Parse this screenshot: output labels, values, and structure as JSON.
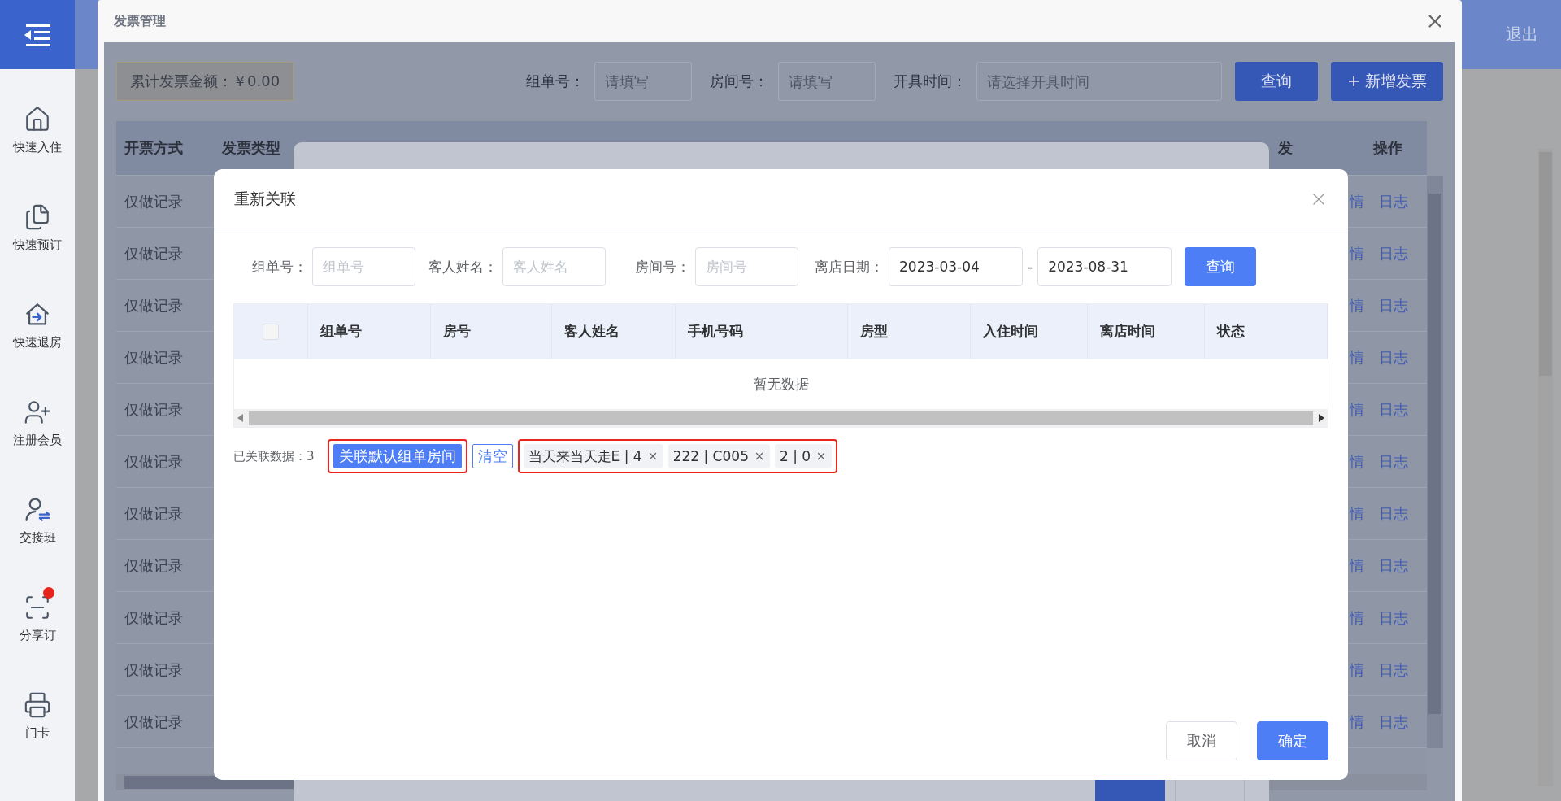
{
  "sidebar": {
    "items": [
      {
        "label": "快速入住",
        "badge": false
      },
      {
        "label": "快速预订",
        "badge": false
      },
      {
        "label": "快速退房",
        "badge": false
      },
      {
        "label": "注册会员",
        "badge": false
      },
      {
        "label": "交接班",
        "badge": false
      },
      {
        "label": "分享订",
        "badge": true
      },
      {
        "label": "门卡",
        "badge": false
      }
    ]
  },
  "top_bar": {
    "logout": "退出"
  },
  "invoice_window": {
    "title": "发票管理",
    "summary": "累计发票金额：￥0.00",
    "filters": [
      {
        "kind": "text",
        "label": "组单号：",
        "placeholder": "请填写"
      },
      {
        "kind": "text",
        "label": "房间号：",
        "placeholder": "请填写"
      },
      {
        "kind": "date",
        "label": "开具时间：",
        "placeholder": "请选择开具时间"
      }
    ],
    "buttons": [
      {
        "label": "查询"
      },
      {
        "label": "+ 新增发票"
      }
    ],
    "table": {
      "columns": [
        "开票方式",
        "发票类型",
        "发"
      ],
      "actions_header": "操作",
      "rows": [
        {
          "method": "仅做记录",
          "actions": [
            "情",
            "日志"
          ]
        },
        {
          "method": "仅做记录",
          "actions": [
            "情",
            "日志"
          ]
        },
        {
          "method": "仅做记录",
          "actions": [
            "情",
            "日志"
          ]
        },
        {
          "method": "仅做记录",
          "actions": [
            "情",
            "日志"
          ]
        },
        {
          "method": "仅做记录",
          "actions": [
            "情",
            "日志"
          ]
        },
        {
          "method": "仅做记录",
          "actions": [
            "情",
            "日志"
          ]
        },
        {
          "method": "仅做记录",
          "actions": [
            "情",
            "日志"
          ]
        },
        {
          "method": "仅做记录",
          "actions": [
            "情",
            "日志"
          ]
        },
        {
          "method": "仅做记录",
          "actions": [
            "情",
            "日志"
          ]
        },
        {
          "method": "仅做记录",
          "actions": [
            "情",
            "日志"
          ]
        },
        {
          "method": "仅做记录",
          "actions": [
            "情",
            "日志"
          ]
        }
      ]
    }
  },
  "relink_dialog": {
    "title": "重新关联",
    "filters": [
      {
        "label": "组单号：",
        "placeholder": "组单号"
      },
      {
        "label": "客人姓名：",
        "placeholder": "客人姓名"
      },
      {
        "label": "房间号：",
        "placeholder": "房间号"
      }
    ],
    "date_range": {
      "label": "离店日期：",
      "start": "2023-03-04",
      "separator": "-",
      "end": "2023-08-31"
    },
    "search_button": "查询",
    "table": {
      "select_all_checked": false,
      "columns": [
        "组单号",
        "房号",
        "客人姓名",
        "手机号码",
        "房型",
        "入住时间",
        "离店时间",
        "状态"
      ],
      "empty_text": "暂无数据"
    },
    "linked": {
      "label": "已关联数据：3",
      "default_button": {
        "label": "关联默认组单房间",
        "highlighted": true
      },
      "clear_button": "清空",
      "tags_highlighted": true,
      "tags": [
        {
          "label": "当天来当天走E | 4"
        },
        {
          "label": "222 | C005"
        },
        {
          "label": "2 | 0"
        }
      ]
    },
    "footer_buttons": [
      {
        "label": "取消",
        "primary": false
      },
      {
        "label": "确定",
        "primary": true
      }
    ]
  }
}
